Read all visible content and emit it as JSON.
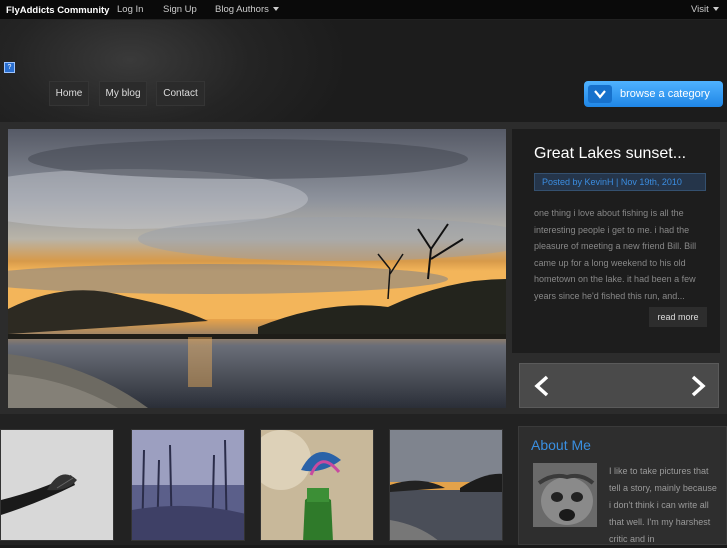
{
  "topbar": {
    "brand": "FlyAddicts Community",
    "login": "Log In",
    "signup": "Sign Up",
    "blog_authors": "Blog Authors",
    "visit": "Visit"
  },
  "nav": {
    "home": "Home",
    "my_blog": "My blog",
    "contact": "Contact"
  },
  "browse": {
    "label": "browse a category"
  },
  "featured_post": {
    "title": "Great Lakes sunset...",
    "meta": "Posted by KevinH | Nov 19th, 2010",
    "excerpt": "one thing i love about fishing is all the interesting people i get to me. i had the pleasure of meeting a new friend Bill. Bill came up for a long weekend to his old hometown on the lake. it had been a few years since he'd fished this run, and...",
    "read_more": "read more"
  },
  "about": {
    "title": "About Me",
    "text": "I like to take pictures that tell a story, mainly because i don't think i can write all that well. I'm my harshest critic and in"
  },
  "colors": {
    "accent": "#3a8fe0",
    "browse_button": "#1f86e6",
    "background": "#1a1a1a"
  }
}
